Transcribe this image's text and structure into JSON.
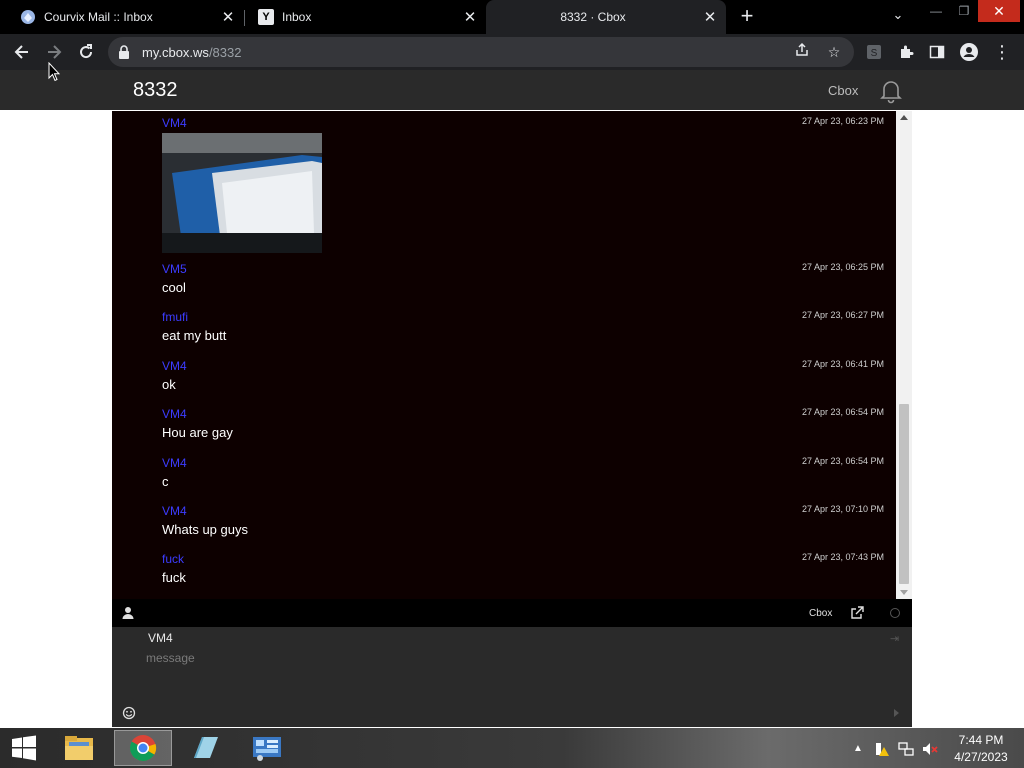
{
  "tabs": [
    {
      "title": "Courvix Mail :: Inbox",
      "active": false
    },
    {
      "title": "Inbox",
      "active": false
    },
    {
      "title": "8332 · Cbox",
      "active": true
    }
  ],
  "address_bar": {
    "host": "my.cbox.ws",
    "path": "/8332"
  },
  "page": {
    "title": "8332",
    "cbox_link": "Cbox"
  },
  "messages": [
    {
      "user": "VM4",
      "time": "27 Apr 23, 06:23 PM",
      "text": "",
      "has_image": true
    },
    {
      "user": "VM5",
      "time": "27 Apr 23, 06:25 PM",
      "text": "cool"
    },
    {
      "user": "fmufi",
      "time": "27 Apr 23, 06:27 PM",
      "text": "eat my butt"
    },
    {
      "user": "VM4",
      "time": "27 Apr 23, 06:41 PM",
      "text": "ok"
    },
    {
      "user": "VM4",
      "time": "27 Apr 23, 06:54 PM",
      "text": "Hou are gay"
    },
    {
      "user": "VM4",
      "time": "27 Apr 23, 06:54 PM",
      "text": "c"
    },
    {
      "user": "VM4",
      "time": "27 Apr 23, 07:10 PM",
      "text": "Whats up guys"
    },
    {
      "user": "fuck",
      "time": "27 Apr 23, 07:43 PM",
      "text": "fuck"
    }
  ],
  "footer": {
    "cbox_label": "Cbox"
  },
  "post_form": {
    "name": "VM4",
    "message_placeholder": "message"
  },
  "taskbar": {
    "time": "7:44 PM",
    "date": "4/27/2023"
  },
  "colors": {
    "username": "#3c3cff",
    "chat_bg": "#0d0000",
    "header_bg": "#2a2a2a",
    "close_red": "#c42b1c"
  },
  "icons": [
    "shield-favicon-icon",
    "yahoo-favicon-icon",
    "back-icon",
    "forward-icon",
    "reload-icon",
    "lock-icon",
    "share-icon",
    "star-icon",
    "extension-icon",
    "sidepanel-icon",
    "profile-icon",
    "menu-icon",
    "bell-icon",
    "user-icon",
    "popout-icon",
    "smiley-icon",
    "windows-logo-icon",
    "folder-icon",
    "chrome-icon"
  ]
}
